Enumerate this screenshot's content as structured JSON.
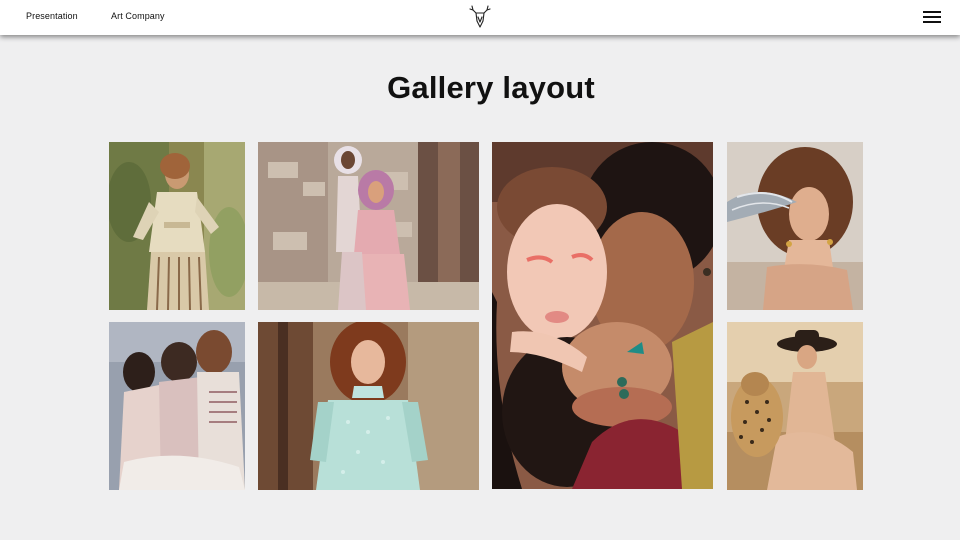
{
  "nav": {
    "links": [
      "Presentation",
      "Art Company"
    ],
    "logo_icon": "deer-head-icon",
    "menu_icon": "hamburger-menu-icon"
  },
  "main": {
    "title": "Gallery layout"
  },
  "colors": {
    "background": "#efeff0",
    "topbar": "#ffffff",
    "text": "#111111"
  }
}
